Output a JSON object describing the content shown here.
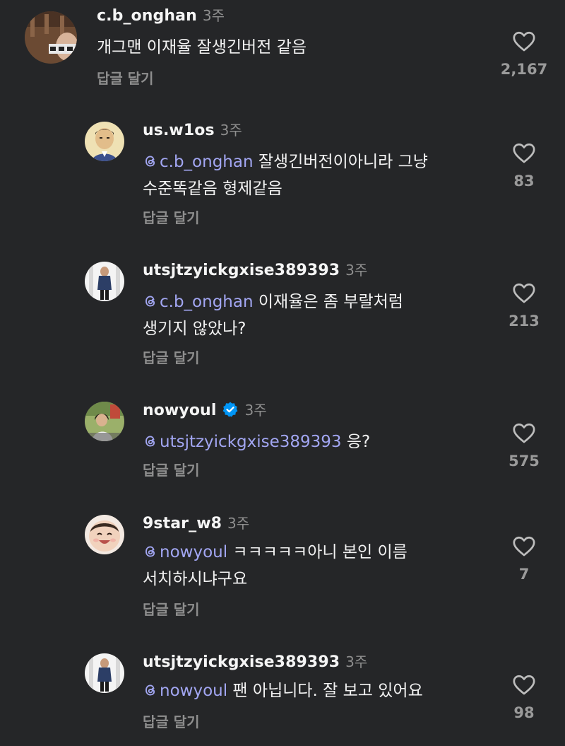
{
  "comments": [
    {
      "username": "c.b_onghan",
      "time": "3주",
      "text_line1": "개그맨 이재율 잘생긴버전 같음",
      "reply_label": "답글 달기",
      "likes": "2,167"
    },
    {
      "username": "us.w1os",
      "time": "3주",
      "mention": "c.b_onghan",
      "text_line1": " 잘생긴버전이아니라 그냥",
      "text_line2": "수준똑같음 형제같음",
      "reply_label": "답글 달기",
      "likes": "83"
    },
    {
      "username": "utsjtzyickgxise389393",
      "time": "3주",
      "mention": "c.b_onghan",
      "text_line1": " 이재율은 좀 부랄처럼",
      "text_line2": "생기지 않았나?",
      "reply_label": "답글 달기",
      "likes": "213"
    },
    {
      "username": "nowyoul",
      "time": "3주",
      "mention": "utsjtzyickgxise389393",
      "text_line1": " 응?",
      "reply_label": "답글 달기",
      "likes": "575"
    },
    {
      "username": "9star_w8",
      "time": "3주",
      "mention": "nowyoul",
      "text_line1": " ㅋㅋㅋㅋㅋ아니 본인 이름",
      "text_line2": "서치하시냐구요",
      "reply_label": "답글 달기",
      "likes": "7"
    },
    {
      "username": "utsjtzyickgxise389393",
      "time": "3주",
      "mention": "nowyoul",
      "text_line1": " 팬 아닙니다. 잘 보고 있어요",
      "reply_label": "답글 달기",
      "likes": "98"
    }
  ],
  "colors": {
    "background": "#252628",
    "mention": "#a2a6f2",
    "muted": "#8e8e8e",
    "verified": "#0095f6"
  }
}
